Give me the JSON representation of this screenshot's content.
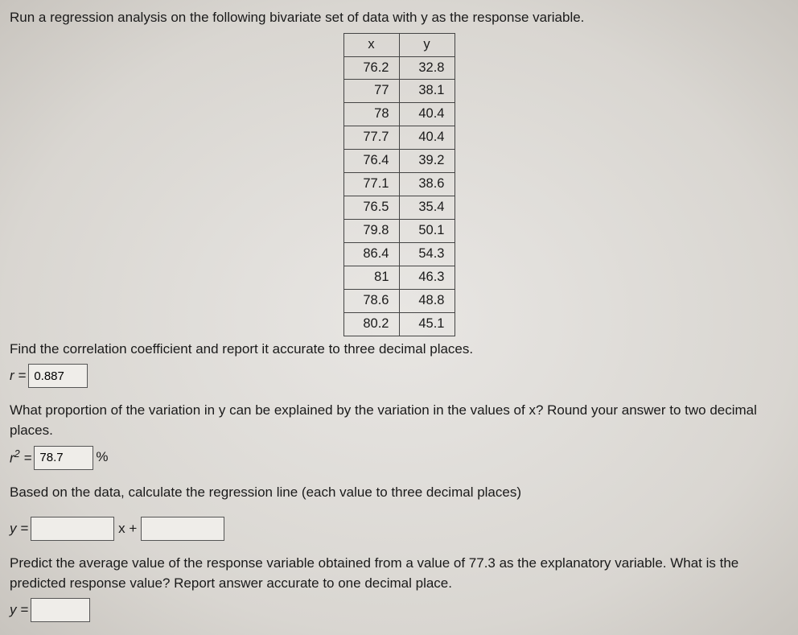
{
  "intro": "Run a regression analysis on the following bivariate set of data with y as the response variable.",
  "table": {
    "headers": {
      "x": "x",
      "y": "y"
    },
    "rows": [
      {
        "x": "76.2",
        "y": "32.8"
      },
      {
        "x": "77",
        "y": "38.1"
      },
      {
        "x": "78",
        "y": "40.4"
      },
      {
        "x": "77.7",
        "y": "40.4"
      },
      {
        "x": "76.4",
        "y": "39.2"
      },
      {
        "x": "77.1",
        "y": "38.6"
      },
      {
        "x": "76.5",
        "y": "35.4"
      },
      {
        "x": "79.8",
        "y": "50.1"
      },
      {
        "x": "86.4",
        "y": "54.3"
      },
      {
        "x": "81",
        "y": "46.3"
      },
      {
        "x": "78.6",
        "y": "48.8"
      },
      {
        "x": "80.2",
        "y": "45.1"
      }
    ]
  },
  "q1": {
    "prompt": "Find the correlation coefficient and report it accurate to three decimal places.",
    "label": "r =",
    "value": "0.887"
  },
  "q2": {
    "prompt": "What proportion of the variation in y can be explained by the variation in the values of x? Round your answer to two decimal places.",
    "label_html_pre": "r",
    "label_html_sup": "2",
    "label_html_post": " =",
    "value": "78.7",
    "unit": "%"
  },
  "q3": {
    "prompt": "Based on the data, calculate the regression line (each value to three decimal places)",
    "y_eq": "y =",
    "x_plus": "x +",
    "slope": "",
    "intercept": ""
  },
  "q4": {
    "prompt": "Predict the average value of the response variable obtained from a value of 77.3 as the explanatory variable. What is the predicted response value? Report answer accurate to one decimal place.",
    "y_eq": "y =",
    "value": ""
  }
}
